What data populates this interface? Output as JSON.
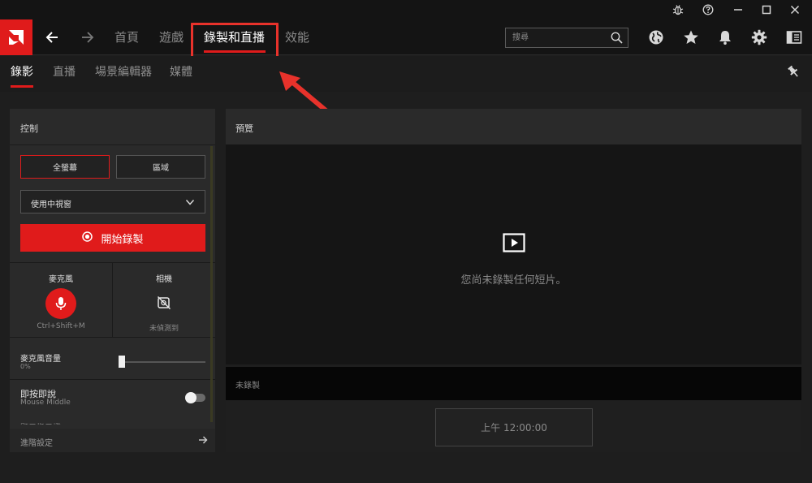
{
  "nav": {
    "items": [
      "首頁",
      "遊戲",
      "錄製和直播",
      "效能"
    ],
    "active_index": 2
  },
  "search": {
    "placeholder": "搜尋"
  },
  "subtabs": {
    "items": [
      "錄影",
      "直播",
      "場景編輯器",
      "媒體"
    ],
    "active_index": 0
  },
  "controls": {
    "title": "控制",
    "mode_fullscreen": "全螢幕",
    "mode_region": "區域",
    "window_select": "使用中視窗",
    "record_button": "開始錄製",
    "microphone": {
      "label": "麥克風",
      "hotkey": "Ctrl+Shift+M"
    },
    "camera": {
      "label": "相機",
      "status": "未偵測到"
    },
    "mic_volume": {
      "label": "麥克風音量",
      "value": "0%"
    },
    "push_to_talk": {
      "label": "即按即說",
      "key": "Mouse Middle",
      "enabled": false
    },
    "cutoff_label": "顯示指示燈",
    "advanced": "進階設定"
  },
  "preview": {
    "title": "預覽",
    "empty_message": "您尚未錄製任何短片。",
    "status": "未錄製",
    "time": "上午 12:00:00"
  },
  "colors": {
    "accent": "#e01b1b",
    "highlight": "#e8322b"
  },
  "icons": [
    "bug-icon",
    "help-icon",
    "minimize-icon",
    "maximize-icon",
    "close-icon",
    "amd-logo-icon",
    "back-arrow-icon",
    "forward-arrow-icon",
    "search-icon",
    "globe-icon",
    "star-icon",
    "bell-icon",
    "gear-icon",
    "sidebar-icon",
    "pin-icon",
    "record-icon",
    "chevron-down-icon",
    "microphone-icon",
    "camera-off-icon",
    "arrow-right-icon",
    "play-icon"
  ]
}
